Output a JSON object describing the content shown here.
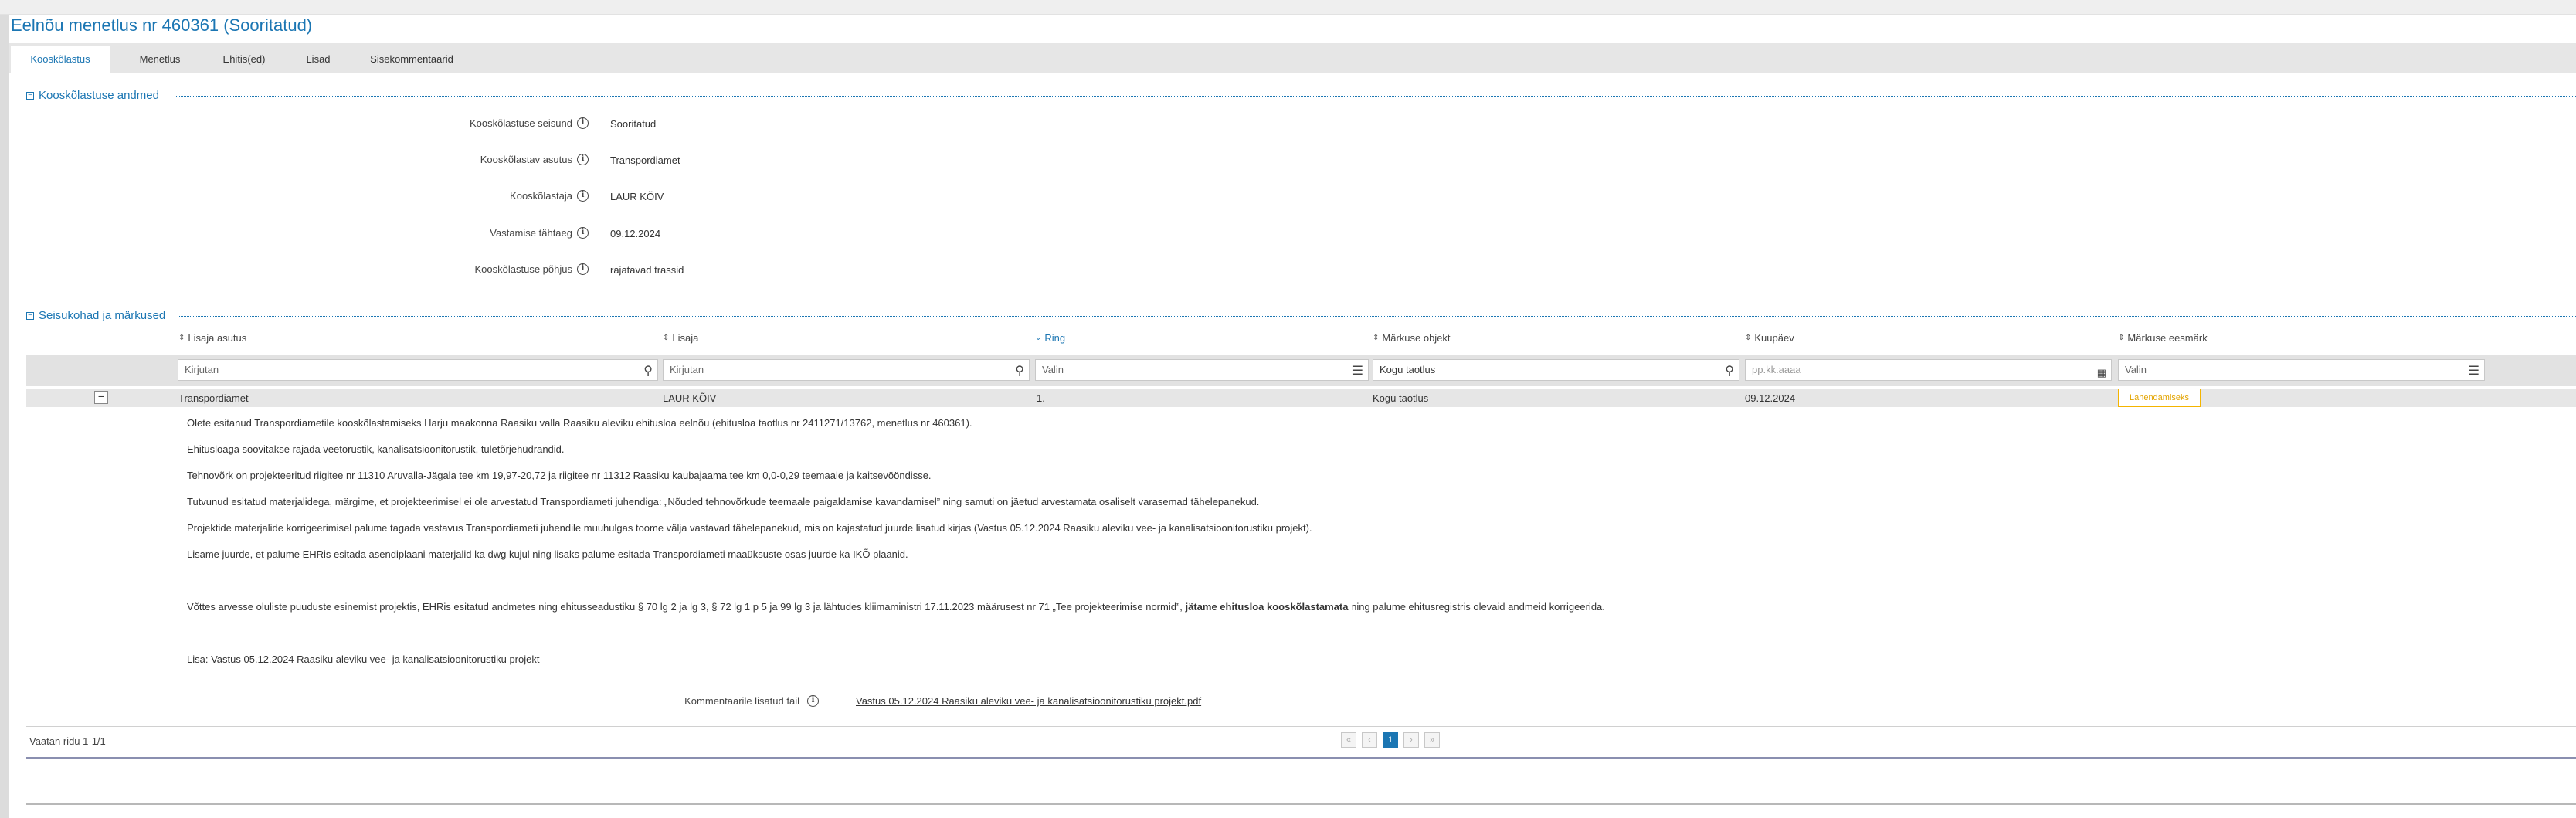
{
  "page": {
    "title": "Eelnõu menetlus nr 460361 (Sooritatud)"
  },
  "tabs": [
    {
      "label": "Kooskõlastus",
      "active": true
    },
    {
      "label": "Menetlus",
      "active": false
    },
    {
      "label": "Ehitis(ed)",
      "active": false
    },
    {
      "label": "Lisad",
      "active": false
    },
    {
      "label": "Sisekommentaarid",
      "active": false
    }
  ],
  "coordination_section": {
    "title": "Kooskõlastuse andmed",
    "fields": [
      {
        "label": "Kooskõlastuse seisund",
        "value": "Sooritatud"
      },
      {
        "label": "Kooskõlastav asutus",
        "value": "Transpordiamet"
      },
      {
        "label": "Kooskõlastaja",
        "value": "LAUR KÕIV"
      },
      {
        "label": "Vastamise tähtaeg",
        "value": "09.12.2024"
      },
      {
        "label": "Kooskõlastuse põhjus",
        "value": "rajatavad trassid"
      }
    ]
  },
  "positions_section": {
    "title": "Seisukohad ja märkused",
    "columns": [
      {
        "label": "Lisaja asutus",
        "sort": "none"
      },
      {
        "label": "Lisaja",
        "sort": "none"
      },
      {
        "label": "Ring",
        "sort": "desc"
      },
      {
        "label": "Märkuse objekt",
        "sort": "none"
      },
      {
        "label": "Kuupäev",
        "sort": "none"
      },
      {
        "label": "Märkuse eesmärk",
        "sort": "none"
      }
    ],
    "filters": [
      {
        "placeholder": "Kirjutan",
        "icon": "search-icon"
      },
      {
        "placeholder": "Kirjutan",
        "icon": "search-icon"
      },
      {
        "placeholder": "Valin",
        "icon": "list-icon"
      },
      {
        "value": "Kogu taotlus",
        "icon": "search-icon"
      },
      {
        "placeholder": "pp.kk.aaaa",
        "icon": "calendar-icon"
      },
      {
        "placeholder": "Valin",
        "icon": "list-icon"
      }
    ],
    "row": {
      "expand_symbol": "−",
      "institution": "Transpordiamet",
      "author": "LAUR KÕIV",
      "round": "1.",
      "object": "Kogu taotlus",
      "date": "09.12.2024",
      "purpose": "Lahendamiseks"
    },
    "comment": {
      "lines": [
        "Olete esitanud Transpordiametile kooskõlastamiseks Harju maakonna Raasiku valla Raasiku aleviku ehitusloa eelnõu (ehitusloa taotlus nr 2411271/13762, menetlus nr 460361).",
        "Ehitusloaga soovitakse rajada veetorustik, kanalisatsioonitorustik, tuletõrjehüdrandid.",
        "Tehnovõrk on projekteeritud riigitee nr 11310 Aruvalla-Jägala tee km 19,97-20,72 ja riigitee nr 11312 Raasiku kaubajaama tee km 0,0-0,29 teemaale ja kaitsevööndisse.",
        "Tutvunud esitatud materjalidega, märgime, et projekteerimisel ei ole arvestatud Transpordiameti juhendiga: „Nõuded tehnovõrkude teemaale paigaldamise kavandamisel” ning samuti on jäetud arvestamata osaliselt varasemad tähelepanekud.",
        "Projektide materjalide korrigeerimisel palume tagada vastavus Transpordiameti juhendile muuhulgas toome välja vastavad tähelepanekud, mis on kajastatud juurde lisatud kirjas (Vastus 05.12.2024 Raasiku aleviku vee- ja kanalisatsioonitorustiku projekt).",
        "Lisame juurde, et palume EHRis esitada asendiplaani materjalid ka dwg kujul ning lisaks palume esitada Transpordiameti maaüksuste osas juurde ka IKÕ plaanid."
      ],
      "decision_pre": "Võttes arvesse oluliste puuduste esinemist projektis, EHRis esitatud andmetes ning ehitusseadustiku § 70 lg 2 ja lg 3, § 72 lg 1 p 5 ja 99 lg 3 ja lähtudes kliimaministri 17.11.2023 määrusest nr 71 „Tee projekteerimise normid”, ",
      "decision_bold": "jätame ehitusloa kooskõlastamata",
      "decision_post": " ning palume ehitusregistris olevaid andmeid korrigeerida.",
      "attachment_note": "Lisa: Vastus 05.12.2024 Raasiku aleviku vee- ja kanalisatsioonitorustiku projekt",
      "file_label": "Kommentaarile lisatud fail",
      "file_name": "Vastus 05.12.2024 Raasiku aleviku vee- ja kanalisatsioonitorustiku projekt.pdf"
    },
    "footer": {
      "rows_info": "Vaatan ridu 1-1/1",
      "pages": [
        "«",
        "‹",
        "1",
        "›",
        "»"
      ],
      "current_page": "1"
    }
  },
  "colors": {
    "accent": "#1b76b3",
    "badge": "#f4b400"
  }
}
